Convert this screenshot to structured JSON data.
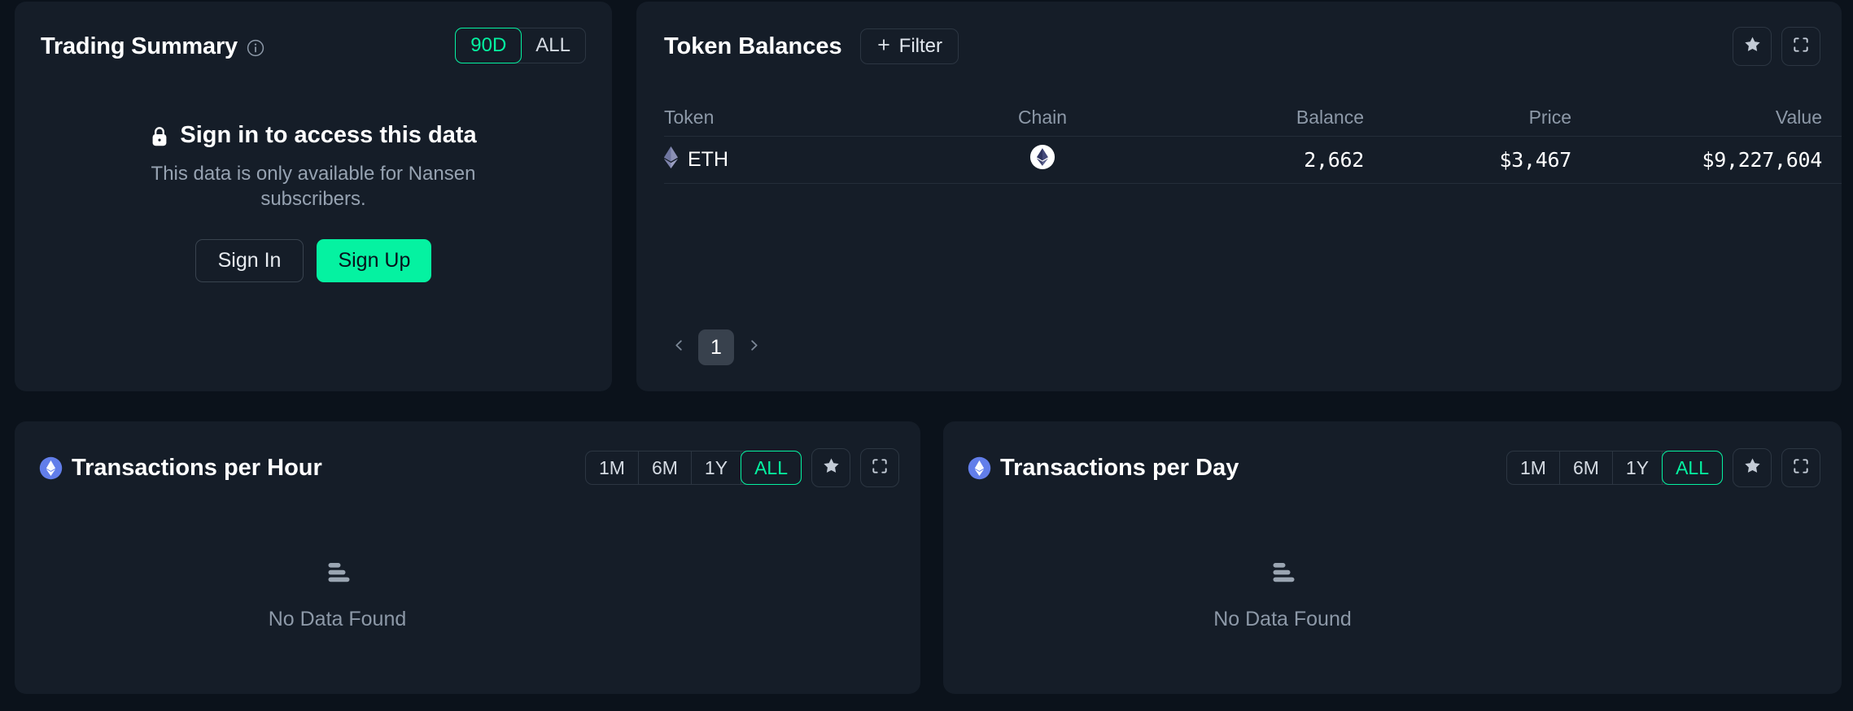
{
  "theme": {
    "page_bg": "#0b121b",
    "panel_bg": "#151d28",
    "accent_green": "#05f2a1",
    "text_primary": "#ffffff",
    "text_muted": "#8d99a8",
    "border": "#2c3642"
  },
  "trading_summary": {
    "title": "Trading Summary",
    "info_icon": "info-circle-icon",
    "range_toggle": {
      "options": [
        "90D",
        "ALL"
      ],
      "selected": "90D"
    },
    "locked": {
      "lock_icon": "lock-icon",
      "heading": "Sign in to access this data",
      "subtext": "This data is only available for Nansen subscribers.",
      "sign_in_label": "Sign In",
      "sign_up_label": "Sign Up"
    }
  },
  "token_balances": {
    "title": "Token Balances",
    "filter_label": "Filter",
    "filter_icon": "plus-icon",
    "favorite_icon": "star-icon",
    "expand_icon": "expand-icon",
    "columns": [
      "Token",
      "Chain",
      "Balance",
      "Price",
      "Value"
    ],
    "rows": [
      {
        "token": "ETH",
        "token_icon": "ethereum-icon",
        "chain_icon": "ethereum-chain-icon",
        "balance": "2,662",
        "price": "$3,467",
        "value": "$9,227,604"
      }
    ],
    "pagination": {
      "prev_icon": "chevron-left-icon",
      "next_icon": "chevron-right-icon",
      "current_page": "1"
    }
  },
  "transactions_per_hour": {
    "title": "Transactions per Hour",
    "chain_icon": "ethereum-badge-icon",
    "range_toggle": {
      "options": [
        "1M",
        "6M",
        "1Y",
        "ALL"
      ],
      "selected": "ALL"
    },
    "favorite_icon": "star-icon",
    "expand_icon": "expand-icon",
    "empty_state": {
      "icon": "no-data-bars-icon",
      "text": "No Data Found"
    }
  },
  "transactions_per_day": {
    "title": "Transactions per Day",
    "chain_icon": "ethereum-badge-icon",
    "range_toggle": {
      "options": [
        "1M",
        "6M",
        "1Y",
        "ALL"
      ],
      "selected": "ALL"
    },
    "favorite_icon": "star-icon",
    "expand_icon": "expand-icon",
    "empty_state": {
      "icon": "no-data-bars-icon",
      "text": "No Data Found"
    }
  }
}
